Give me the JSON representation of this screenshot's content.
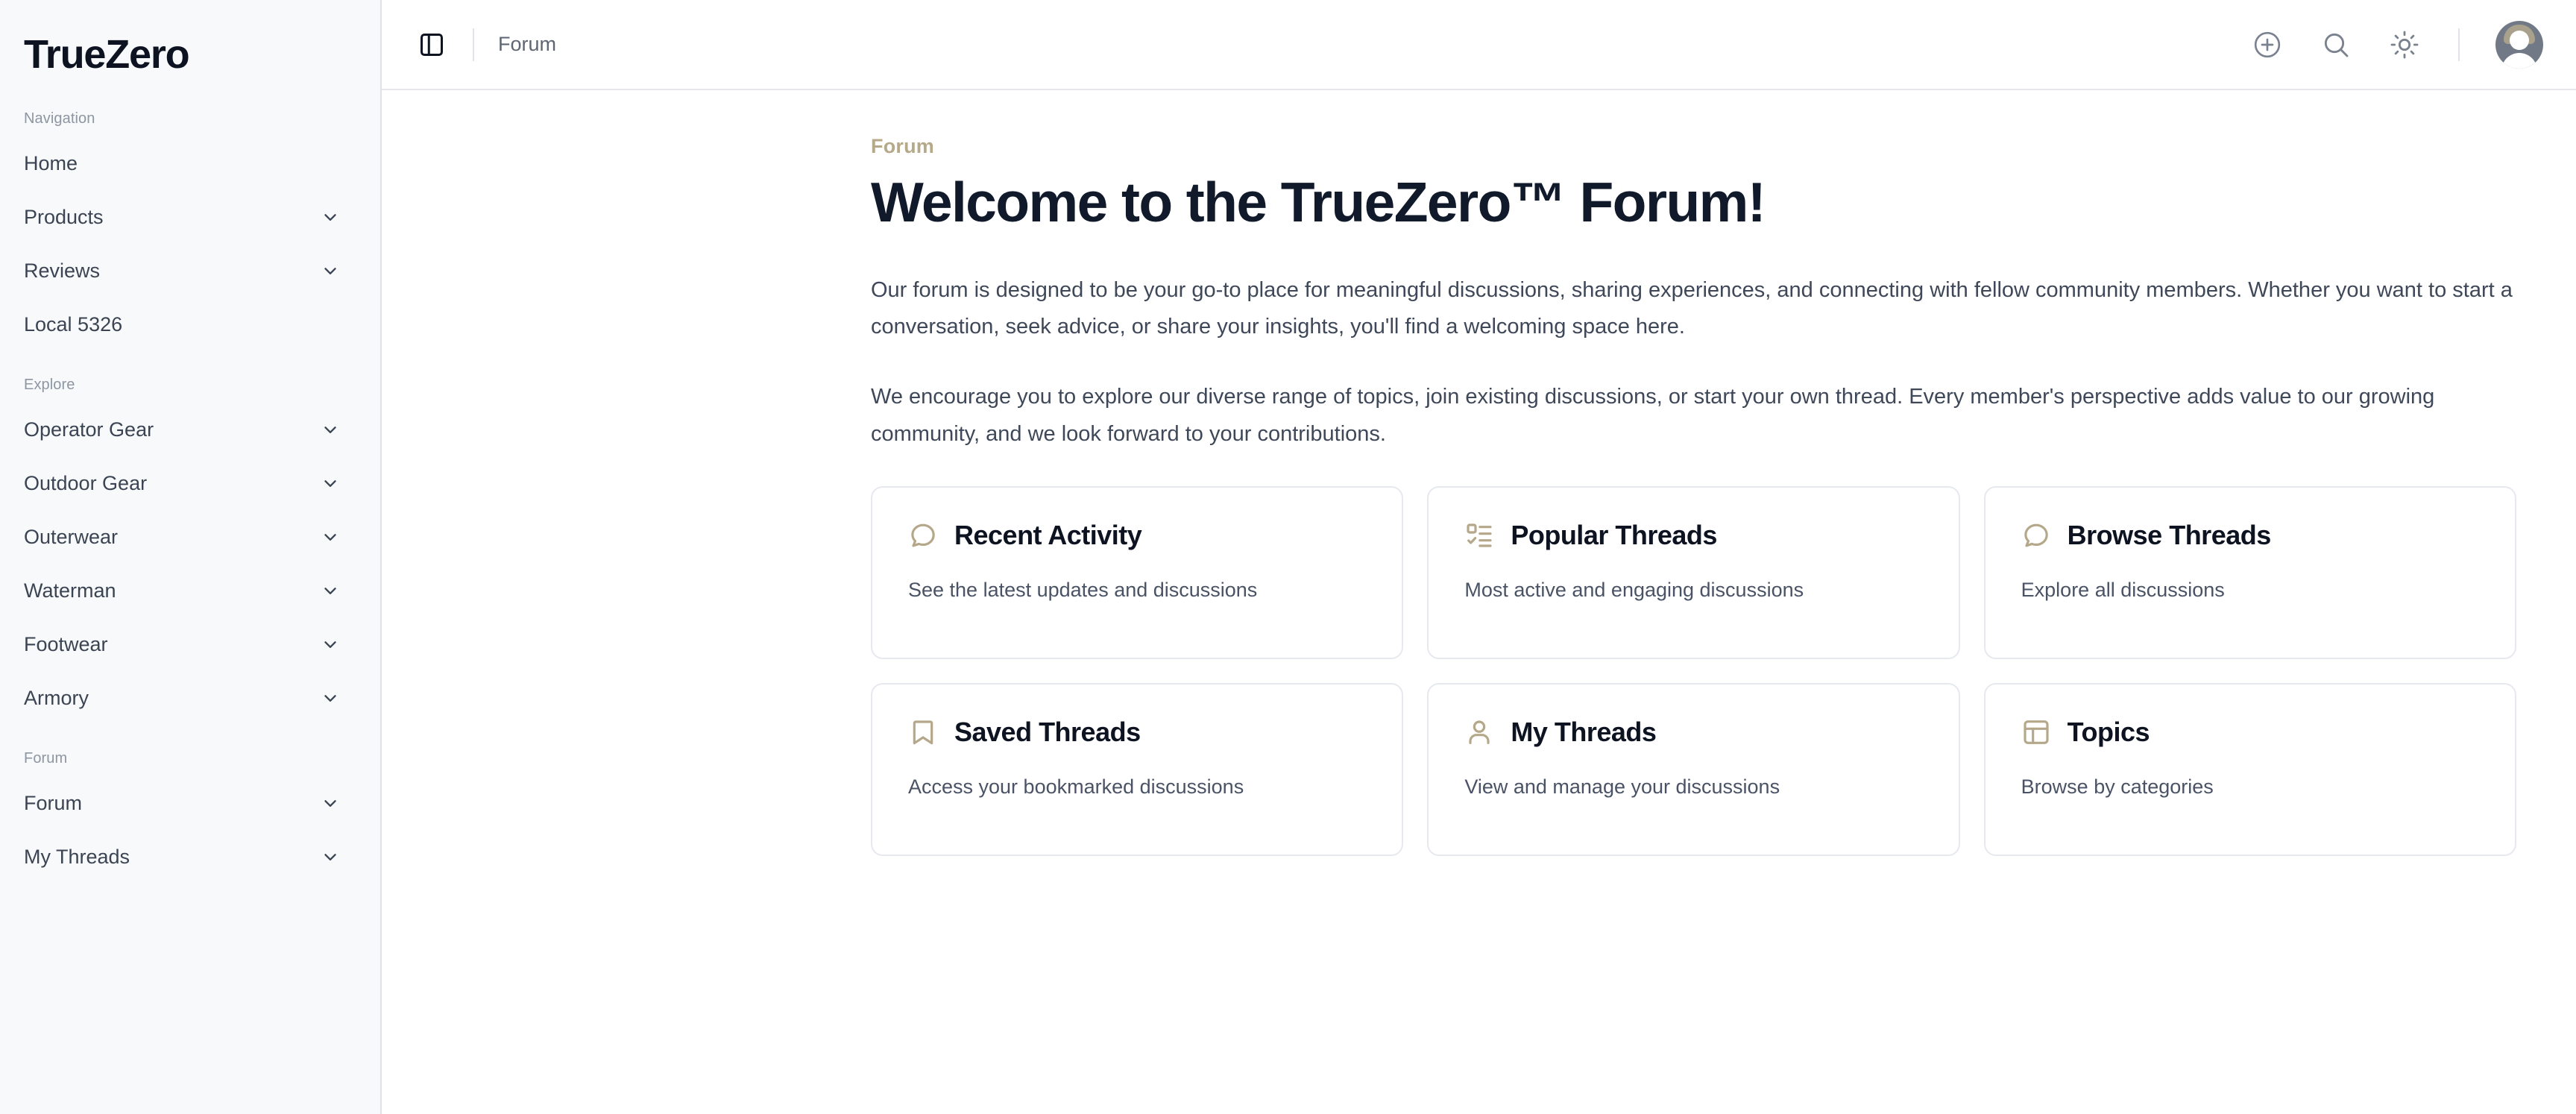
{
  "brand": {
    "name": "TrueZero"
  },
  "sidebar": {
    "groups": [
      {
        "label": "Navigation",
        "items": [
          {
            "label": "Home",
            "chevron": false
          },
          {
            "label": "Products",
            "chevron": true
          },
          {
            "label": "Reviews",
            "chevron": true
          },
          {
            "label": "Local 5326",
            "chevron": false
          }
        ]
      },
      {
        "label": "Explore",
        "items": [
          {
            "label": "Operator Gear",
            "chevron": true
          },
          {
            "label": "Outdoor Gear",
            "chevron": true
          },
          {
            "label": "Outerwear",
            "chevron": true
          },
          {
            "label": "Waterman",
            "chevron": true
          },
          {
            "label": "Footwear",
            "chevron": true
          },
          {
            "label": "Armory",
            "chevron": true
          }
        ]
      },
      {
        "label": "Forum",
        "items": [
          {
            "label": "Forum",
            "chevron": true
          },
          {
            "label": "My Threads",
            "chevron": true
          }
        ]
      }
    ]
  },
  "topbar": {
    "sidebar_toggle_icon": "panel-left-icon",
    "breadcrumb": "Forum",
    "actions": [
      {
        "icon": "plus-circle-icon",
        "name": "new-post-button"
      },
      {
        "icon": "search-icon",
        "name": "search-button"
      },
      {
        "icon": "sun-icon",
        "name": "theme-toggle-button"
      }
    ],
    "avatar_icon": "user-avatar"
  },
  "page": {
    "eyebrow": "Forum",
    "title": "Welcome to the TrueZero™ Forum!",
    "paragraphs": [
      "Our forum is designed to be your go-to place for meaningful discussions, sharing experiences, and connecting with fellow community members. Whether you want to start a conversation, seek advice, or share your insights, you'll find a welcoming space here.",
      "We encourage you to explore our diverse range of topics, join existing discussions, or start your own thread. Every member's perspective adds value to our growing community, and we look forward to your contributions."
    ],
    "cards": [
      {
        "icon": "message-circle-icon",
        "title": "Recent Activity",
        "desc": "See the latest updates and discussions"
      },
      {
        "icon": "list-checks-icon",
        "title": "Popular Threads",
        "desc": "Most active and engaging discussions"
      },
      {
        "icon": "message-circle-icon",
        "title": "Browse Threads",
        "desc": "Explore all discussions"
      },
      {
        "icon": "bookmark-icon",
        "title": "Saved Threads",
        "desc": "Access your bookmarked discussions"
      },
      {
        "icon": "user-icon",
        "title": "My Threads",
        "desc": "View and manage your discussions"
      },
      {
        "icon": "layout-icon",
        "title": "Topics",
        "desc": "Browse by categories"
      }
    ]
  },
  "colors": {
    "accent": "#b5a98a",
    "sidebar_bg": "#f8f9fa",
    "border": "#e6e9ee",
    "title": "#111a2b",
    "body_text": "#3f4859"
  }
}
